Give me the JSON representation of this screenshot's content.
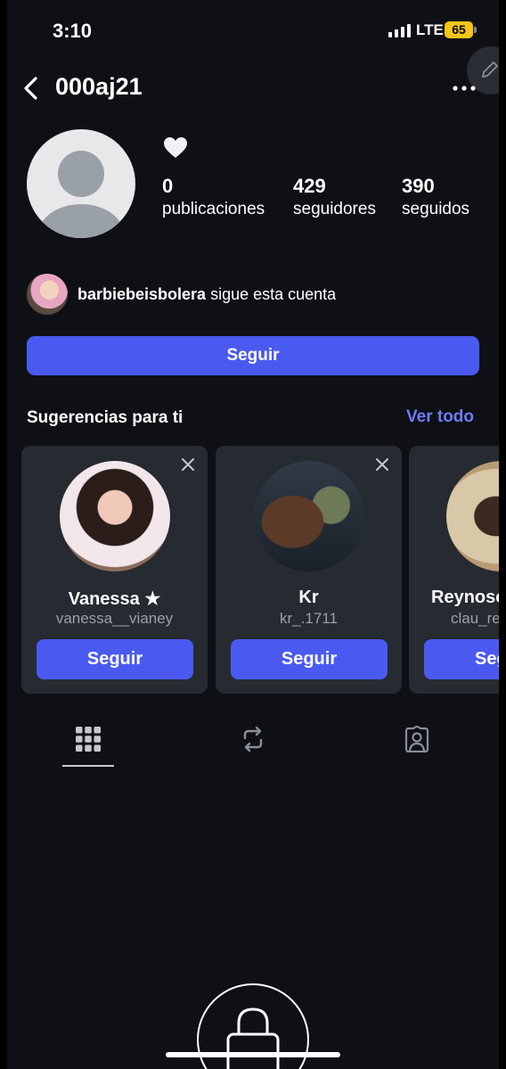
{
  "status_bar": {
    "time": "3:10",
    "network": "LTE",
    "battery": "65"
  },
  "header": {
    "username": "000aj21"
  },
  "profile": {
    "posts_count": "0",
    "posts_label": "publicaciones",
    "followers_count": "429",
    "followers_label": "seguidores",
    "following_count": "390",
    "following_label": "seguidos"
  },
  "mutual": {
    "username": "barbiebeisbolera",
    "text": "sigue esta cuenta"
  },
  "follow_button": "Seguir",
  "suggestions": {
    "title": "Sugerencias para ti",
    "see_all": "Ver todo",
    "cards": [
      {
        "name": "Vanessa ★",
        "handle": "vanessa__vianey",
        "button": "Seguir"
      },
      {
        "name": "Kr",
        "handle": "kr_.1711",
        "button": "Seguir"
      },
      {
        "name": "Reynoso",
        "handle": "clau_re",
        "button": "Seguir"
      }
    ]
  },
  "icons": {
    "back": "chevron-left-icon",
    "more": "more-icon",
    "heart": "heart-icon",
    "grid": "grid-icon",
    "reposts": "repost-icon",
    "tagged": "tagged-icon",
    "lock": "lock-icon"
  },
  "colors": {
    "accent": "#4a5af0",
    "link": "#6d7df5",
    "background": "#0e1015",
    "card": "#262a31",
    "battery": "#f5c518"
  }
}
